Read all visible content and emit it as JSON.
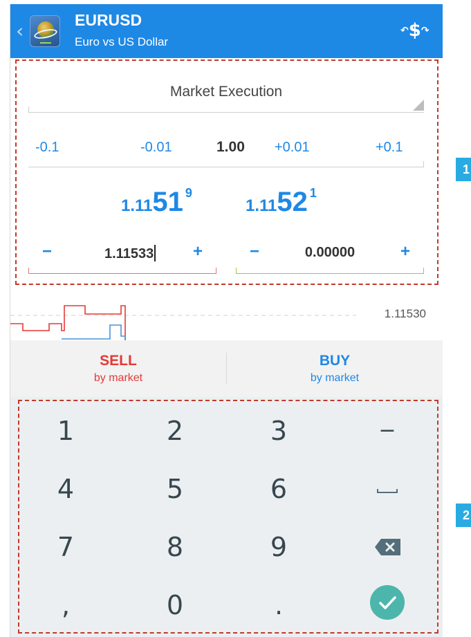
{
  "header": {
    "back_icon": "chevron-left-icon",
    "logo_icon": "metatrader-app-icon",
    "symbol": "EURUSD",
    "description": "Euro vs US Dollar",
    "action_icon": "currency-exchange-icon",
    "background_color": "#1e88e5"
  },
  "order": {
    "execution_type": "Market Execution",
    "volume": {
      "decrease_large": "-0.1",
      "decrease_small": "-0.01",
      "value": "1.00",
      "increase_small": "+0.01",
      "increase_large": "+0.1"
    },
    "bid": {
      "prefix": "1.11",
      "big": "51",
      "sup": "9"
    },
    "ask": {
      "prefix": "1.11",
      "big": "52",
      "sup": "1"
    },
    "stop_loss": {
      "minus": "−",
      "value": "1.11533",
      "plus": "+",
      "line_color": "#e57373"
    },
    "take_profit": {
      "minus": "−",
      "value": "0.00000",
      "plus": "+",
      "line_color": "#9ccc3c"
    }
  },
  "mini_chart": {
    "price_label": "1.11530"
  },
  "trade_buttons": {
    "sell_label": "SELL",
    "sell_sub": "by market",
    "buy_label": "BUY",
    "buy_sub": "by market",
    "sell_color": "#e53935",
    "buy_color": "#1e88e5"
  },
  "keyboard": {
    "keys": [
      {
        "label": "1"
      },
      {
        "label": "2"
      },
      {
        "label": "3"
      },
      {
        "label": "−"
      },
      {
        "label": "4"
      },
      {
        "label": "5"
      },
      {
        "label": "6"
      },
      {
        "label": "space",
        "icon": "space-key-icon"
      },
      {
        "label": "7"
      },
      {
        "label": "8"
      },
      {
        "label": "9"
      },
      {
        "label": "backspace",
        "icon": "backspace-icon"
      },
      {
        "label": ","
      },
      {
        "label": "0"
      },
      {
        "label": "."
      },
      {
        "label": "done",
        "icon": "checkmark-icon"
      }
    ]
  },
  "annotations": {
    "callout_1": "1",
    "callout_2": "2"
  }
}
